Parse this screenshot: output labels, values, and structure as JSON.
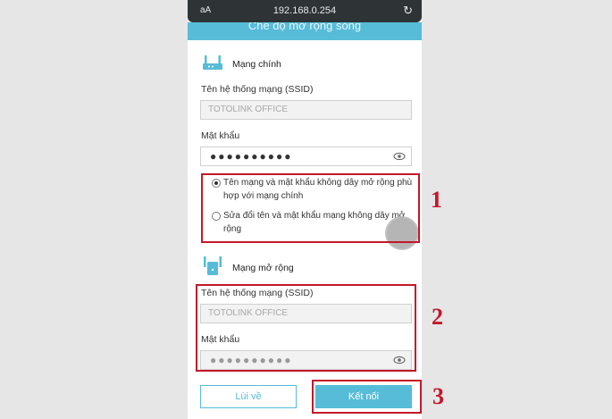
{
  "browser": {
    "text_size_label": "aA",
    "url": "192.168.0.254",
    "reload_icon": "reload-icon"
  },
  "header": {
    "title": "Chế độ mở rộng sóng"
  },
  "main_network": {
    "title": "Mạng chính",
    "icon": "router-icon",
    "ssid_label": "Tên hệ thống mạng (SSID)",
    "ssid_value": "TOTOLINK OFFICE",
    "password_label": "Mật khẩu",
    "password_mask": "●●●●●●●●●●",
    "eye_icon": "eye-icon"
  },
  "options": [
    {
      "label": "Tên mạng và mật khẩu không dây mở rộng phù hợp với mạng chính",
      "selected": true
    },
    {
      "label": "Sửa đổi tên và mật khẩu mạng không dây mở rộng",
      "selected": false
    }
  ],
  "extended_network": {
    "title": "Mạng mở rộng",
    "icon": "extender-icon",
    "ssid_label": "Tên hệ thống mạng (SSID)",
    "ssid_value": "TOTOLINK OFFICE",
    "password_label": "Mật khẩu",
    "password_mask": "●●●●●●●●●●",
    "eye_icon": "eye-icon"
  },
  "buttons": {
    "back": "Lùi về",
    "connect": "Kết nối"
  },
  "annotations": {
    "step1": "1",
    "step2": "2",
    "step3": "3"
  },
  "colors": {
    "accent": "#57bcd8",
    "annotation": "#c3182a"
  }
}
